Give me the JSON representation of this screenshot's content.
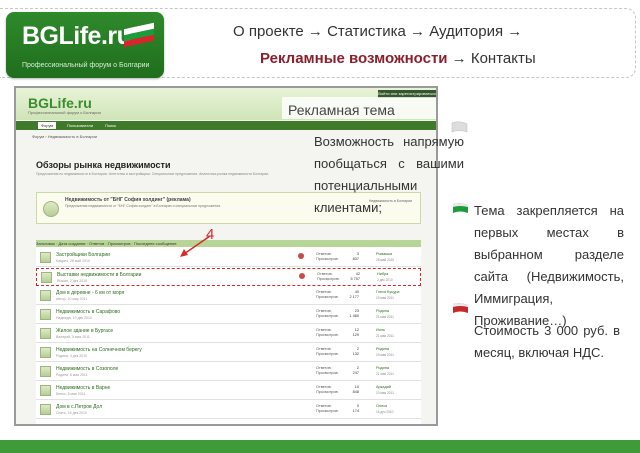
{
  "header": {
    "logo_title": "BGLife.ru",
    "logo_subtitle": "Профессиональный форум о Болгарии",
    "nav_line1": "О проекте → Статистика → Аудитория →",
    "nav_current": "Рекламные возможности",
    "nav_line2_tail": " → Контакты",
    "colors": {
      "brand_green": "#2f8a2b",
      "accent_red": "#8b1f2d"
    }
  },
  "callout": {
    "title": "Рекламная тема",
    "number": "4"
  },
  "lead_text": "Возможность напрямую пообщаться с вашими потенциальными клиентами;",
  "bullets": [
    {
      "icon": "bulgarian-flag-icon",
      "text": "Тема закрепляется на первых местах в выбранном разделе сайта (Недвижимость, Иммиграция, Проживание…)"
    },
    {
      "icon": "bulgarian-flag-icon",
      "text": "Стоимость 3 000 руб. в месяц, включая НДС."
    }
  ],
  "screenshot": {
    "logo": "BGLife.ru",
    "tagline": "Профессиональный форум о Болгарии",
    "top_bar": "Войти или зарегистрироваться",
    "nav": [
      "Форум",
      "Пользователи",
      "Поиск"
    ],
    "breadcrumb": "Форум › Недвижимость в Болгарии",
    "title": "Обзоры рынка недвижимости",
    "description": "Предложения по недвижимости в Болгарии. Агентства и застройщики. Специальные предложения. Аналитика рынка недвижимости Болгарии.",
    "sticky": {
      "title": "Недвижимость от \"БНГ София холдинг\" (реклама)",
      "text": "Предложения недвижимости от \"БНГ София холдинг\" в Болгарии и специальные предложения.",
      "right": "Недвижимость в Болгарии"
    },
    "table_header": "Заголовок · Дата создания · Ответов · Просмотров · Последнее сообщение",
    "rows": [
      {
        "name": "Застройщики Болгарии",
        "by": "Kalgar4, 28 май 2010",
        "replies": "3",
        "views": "837",
        "last": "Ромашка",
        "date": "28 май 2010"
      },
      {
        "name": "Выставки недвижимости в Болгарии",
        "by": "Ruslan, 2 дек 2010",
        "replies": "42",
        "views": "5 757",
        "last": "Нибра",
        "date": "2 дек 2010"
      },
      {
        "name": "Дом в деревне - 6 км от моря",
        "by": "Автор, 10 мар 2011",
        "replies": "40",
        "views": "2 177",
        "last": "Глеся Куцура",
        "date": "19 мая 2011"
      },
      {
        "name": "Недвижимость в Сарафово",
        "by": "Надежда, 10 дек 2010",
        "replies": "23",
        "views": "1 480",
        "last": "Родина",
        "date": "21 мая 2011"
      },
      {
        "name": "Жилое здание в Бургасе",
        "by": "Валерий, 5 мая 2011",
        "replies": "12",
        "views": "129",
        "last": "Иоль",
        "date": "21 мая 2011"
      },
      {
        "name": "Недвижимость на Солнечном берегу",
        "by": "Родина, 4 дек 2010",
        "replies": "2",
        "views": "132",
        "last": "Родина",
        "date": "19 мая 2011"
      },
      {
        "name": "Недвижимость в Созополе",
        "by": "Родина, 6 мая 2011",
        "replies": "2",
        "views": "247",
        "last": "Родина",
        "date": "21 мая 2011"
      },
      {
        "name": "Недвижимость в Варне",
        "by": "Бенко, 8 мая 2011",
        "replies": "10",
        "views": "848",
        "last": "Аркадий",
        "date": "20 мая 2011"
      },
      {
        "name": "Дом в с.Петров Дол",
        "by": "Олегь, 16 дек 2010",
        "replies": "0",
        "views": "174",
        "last": "Олеся",
        "date": "16 дек 2010"
      }
    ],
    "col_labels": {
      "replies": "Ответов:",
      "views": "Просмотров:"
    }
  }
}
